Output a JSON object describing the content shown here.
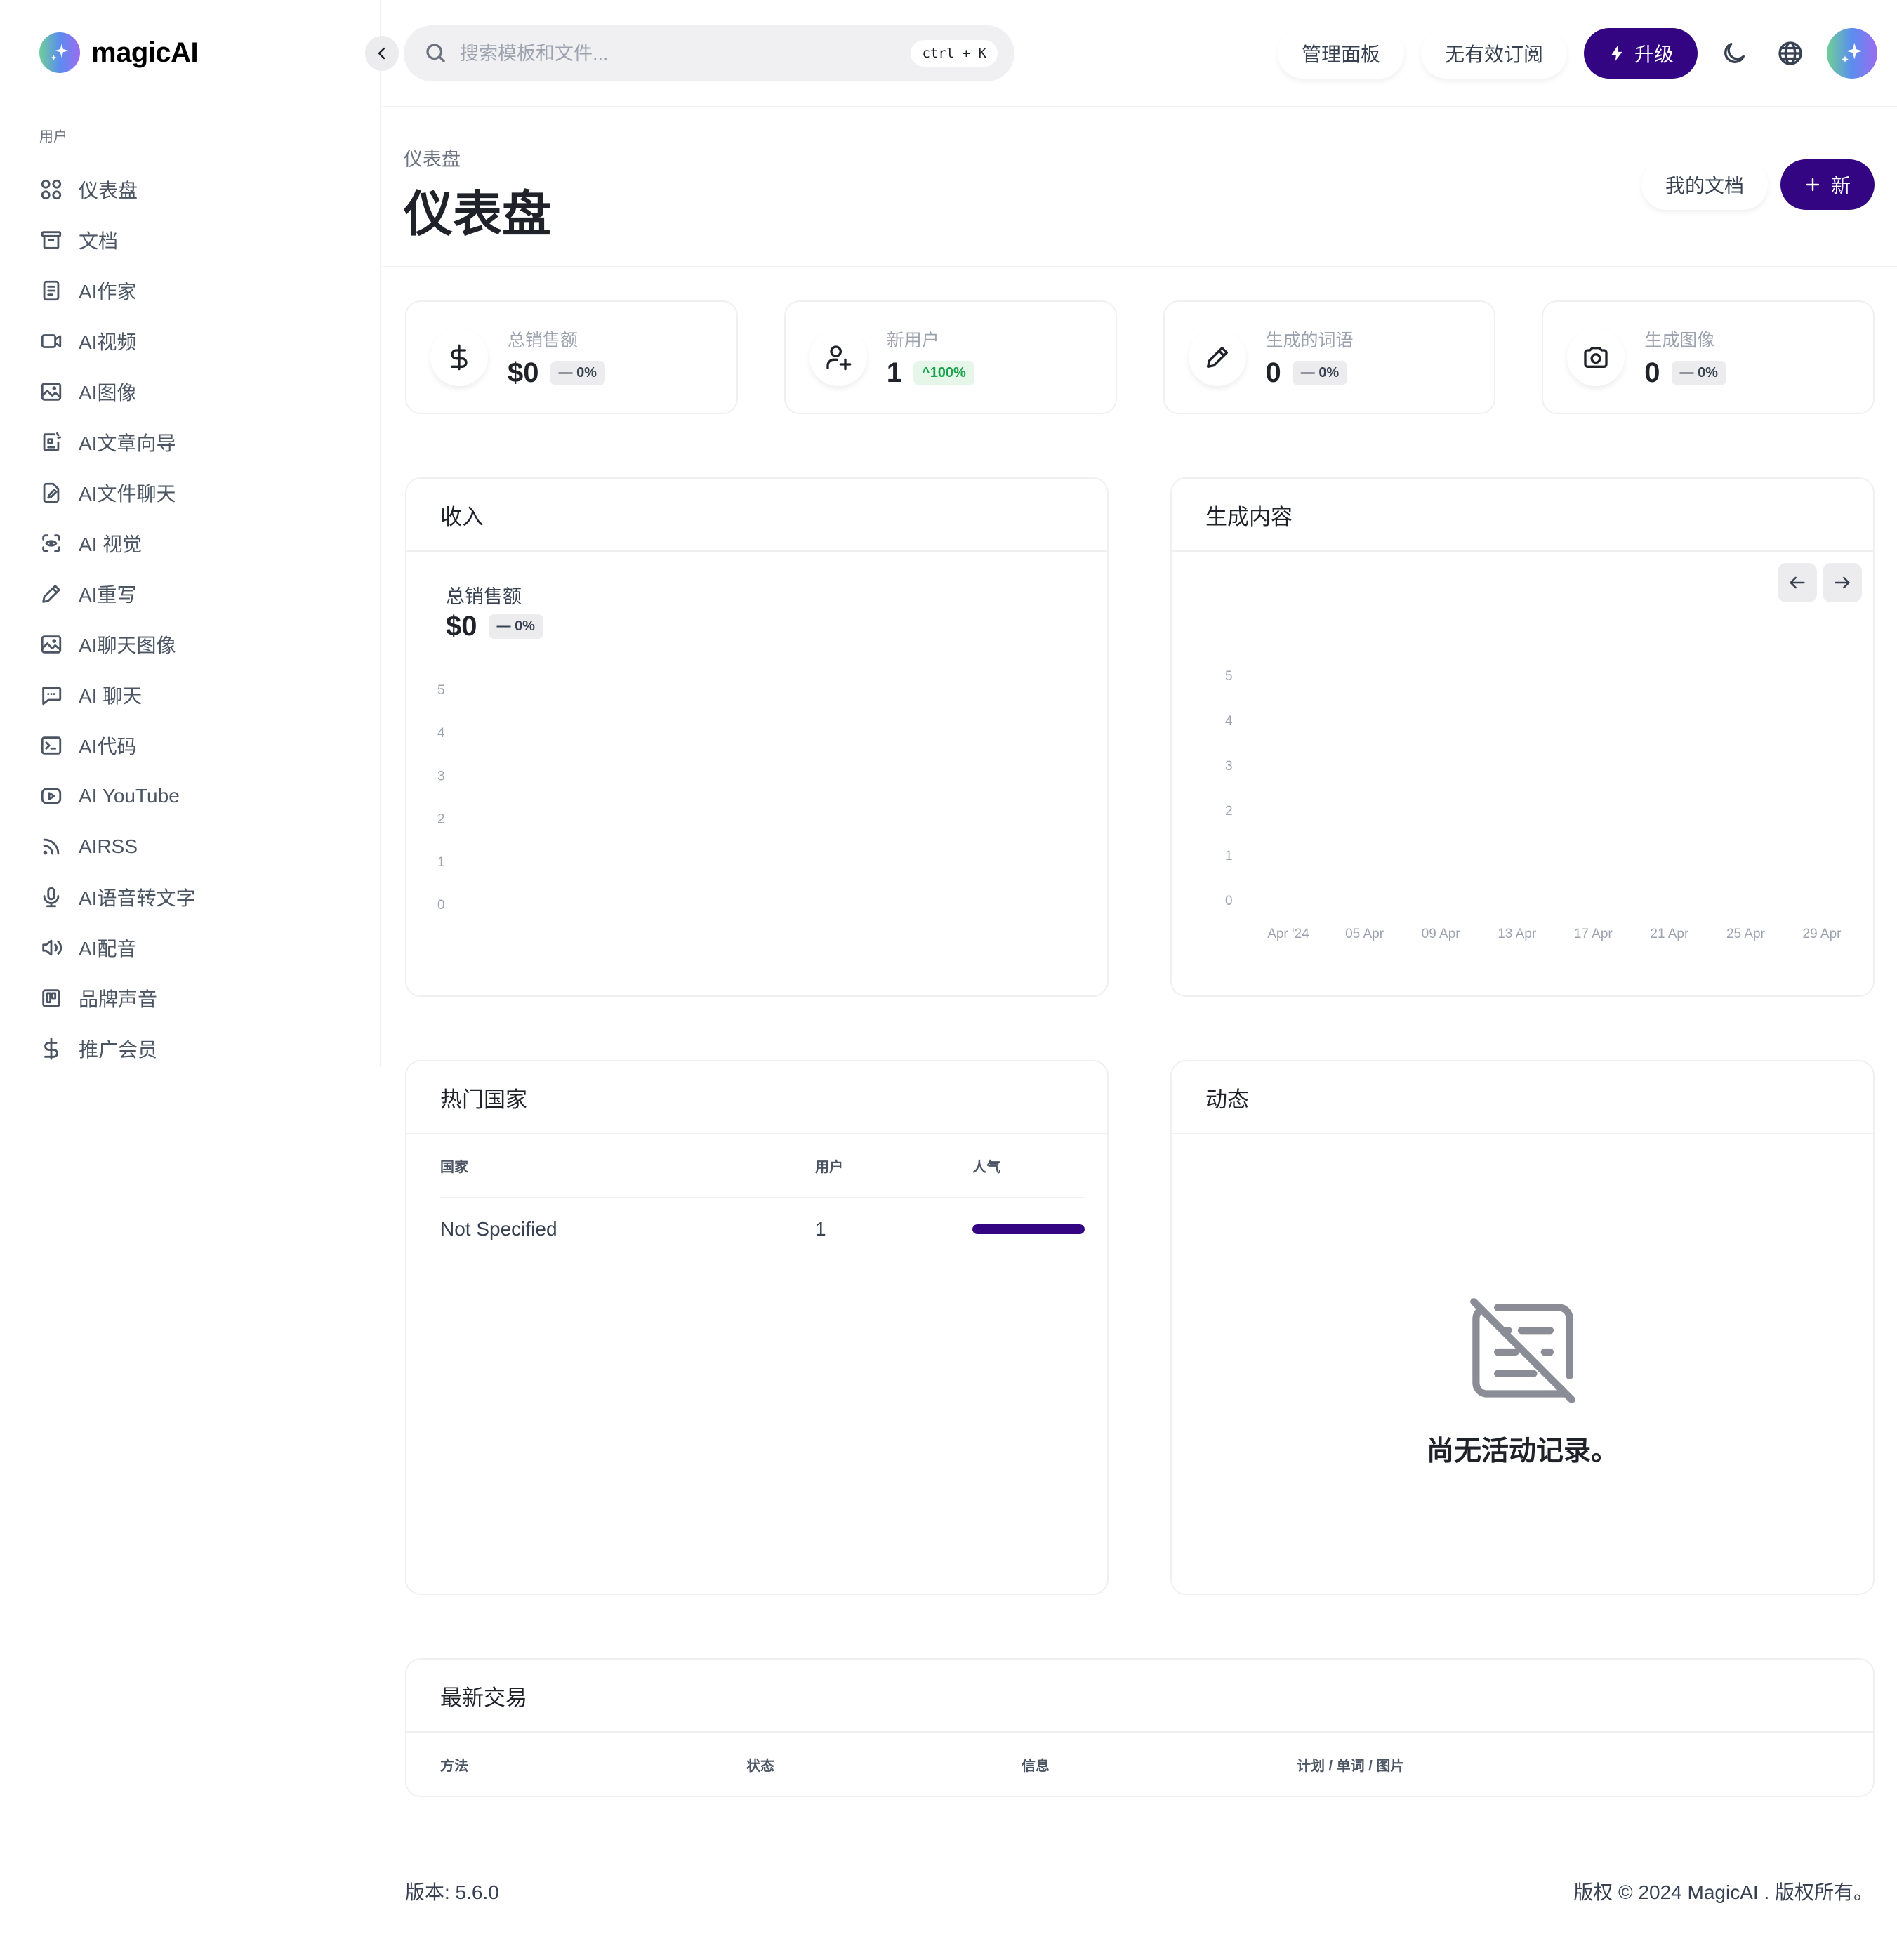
{
  "brand": {
    "name": "magicAI",
    "accent": "#330582"
  },
  "sidebar": {
    "section_label": "用户",
    "items": [
      {
        "label": "仪表盘",
        "icon": "grid-icon"
      },
      {
        "label": "文档",
        "icon": "archive-icon"
      },
      {
        "label": "AI作家",
        "icon": "document-icon"
      },
      {
        "label": "AI视频",
        "icon": "video-icon"
      },
      {
        "label": "AI图像",
        "icon": "image-icon"
      },
      {
        "label": "AI文章向导",
        "icon": "article-wizard-icon"
      },
      {
        "label": "AI文件聊天",
        "icon": "file-edit-icon"
      },
      {
        "label": "AI 视觉",
        "icon": "eye-scan-icon"
      },
      {
        "label": "AI重写",
        "icon": "pencil-icon"
      },
      {
        "label": "AI聊天图像",
        "icon": "image-icon"
      },
      {
        "label": "AI 聊天",
        "icon": "chat-icon"
      },
      {
        "label": "AI代码",
        "icon": "terminal-icon"
      },
      {
        "label": "AI YouTube",
        "icon": "youtube-icon"
      },
      {
        "label": "AIRSS",
        "icon": "rss-icon"
      },
      {
        "label": "AI语音转文字",
        "icon": "microphone-icon"
      },
      {
        "label": "AI配音",
        "icon": "speaker-icon"
      },
      {
        "label": "品牌声音",
        "icon": "brand-voice-icon"
      },
      {
        "label": "推广会员",
        "icon": "dollar-icon"
      }
    ]
  },
  "header": {
    "search_placeholder": "搜索模板和文件...",
    "search_value": "",
    "shortcut": "ctrl + K",
    "admin_panel": "管理面板",
    "subscription": "无有效订阅",
    "upgrade": "升级"
  },
  "page": {
    "breadcrumb": "仪表盘",
    "title": "仪表盘",
    "my_docs": "我的文档",
    "new_label": "新"
  },
  "stats": [
    {
      "label": "总销售额",
      "value": "$0",
      "change": "0%",
      "trend": "flat",
      "icon": "dollar-icon"
    },
    {
      "label": "新用户",
      "value": "1",
      "change": "100%",
      "trend": "up",
      "icon": "user-plus-icon"
    },
    {
      "label": "生成的词语",
      "value": "0",
      "change": "0%",
      "trend": "flat",
      "icon": "pencil-icon"
    },
    {
      "label": "生成图像",
      "value": "0",
      "change": "0%",
      "trend": "flat",
      "icon": "camera-icon"
    }
  ],
  "revenue": {
    "title": "收入",
    "total_label": "总销售额",
    "total_value": "$0",
    "change": "0%"
  },
  "generated": {
    "title": "生成内容"
  },
  "chart_data": [
    {
      "type": "line",
      "title": "收入",
      "xlabel": "",
      "ylabel": "",
      "yticks": [
        0,
        1,
        2,
        3,
        4,
        5
      ],
      "ylim": [
        0,
        5
      ],
      "x": [],
      "series": [],
      "grid": false
    },
    {
      "type": "bar",
      "title": "生成内容",
      "xlabel": "",
      "ylabel": "",
      "yticks": [
        0,
        1,
        2,
        3,
        4,
        5
      ],
      "ylim": [
        0,
        5
      ],
      "categories": [
        "Apr '24",
        "05 Apr",
        "09 Apr",
        "13 Apr",
        "17 Apr",
        "21 Apr",
        "25 Apr",
        "29 Apr"
      ],
      "series": [],
      "grid": false
    }
  ],
  "countries": {
    "title": "热门国家",
    "columns": [
      "国家",
      "用户",
      "人气"
    ],
    "rows": [
      {
        "country": "Not Specified",
        "users": "1",
        "popularity": 1.0
      }
    ]
  },
  "activity": {
    "title": "动态",
    "empty_text": "尚无活动记录。"
  },
  "transactions": {
    "title": "最新交易",
    "columns": [
      "方法",
      "状态",
      "信息",
      "计划 / 单词 / 图片"
    ]
  },
  "footer": {
    "version": "版本: 5.6.0",
    "copyright": "版权 © 2024 MagicAI . 版权所有。"
  }
}
